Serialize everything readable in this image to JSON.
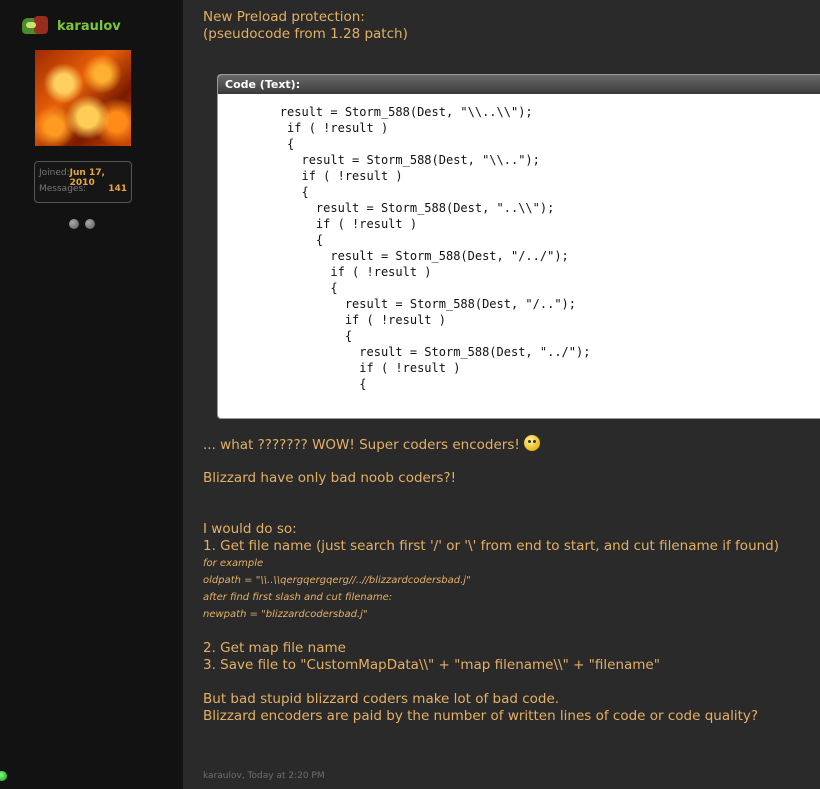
{
  "user": {
    "name": "karaulov",
    "joined_label": "Joined:",
    "joined_value": "Jun 17, 2010",
    "messages_label": "Messages:",
    "messages_value": "141"
  },
  "post": {
    "intro_1": "New Preload protection:",
    "intro_2": "(pseudocode from 1.28 patch)",
    "code_header": "Code (Text):",
    "code_lines": [
      "        result = Storm_588(Dest, \"\\\\..\\\\\");",
      "         if ( !result )",
      "         {",
      "           result = Storm_588(Dest, \"\\\\..\");",
      "           if ( !result )",
      "           {",
      "             result = Storm_588(Dest, \"..\\\\\");",
      "             if ( !result )",
      "             {",
      "               result = Storm_588(Dest, \"/../\");",
      "               if ( !result )",
      "               {",
      "                 result = Storm_588(Dest, \"/..\");",
      "                 if ( !result )",
      "                 {",
      "                   result = Storm_588(Dest, \"../\");",
      "                   if ( !result )",
      "                   {"
    ],
    "reaction": "... what ??????? WOW! Super coders encoders!",
    "smiley_icon": "big-grin-smiley",
    "line_bad_coders": "Blizzard have only bad noob coders?!",
    "would_do": "I would do so:",
    "step_1": "1. Get file name (just search first '/' or '\\' from end to start, and cut filename if found)",
    "example_1": "for example",
    "example_2": "oldpath = \"\\\\..\\\\qergqergqerg//..//blizzardcodersbad.j\"",
    "example_3": "after find first slash and cut filename:",
    "example_4": "newpath = \"blizzardcodersbad.j\"",
    "step_2": "2. Get map file name",
    "step_3": "3. Save file to \"CustomMapData\\\\\" + \"map filename\\\\\" + \"filename\"",
    "closing_1": "But bad stupid blizzard coders make lot of bad code.",
    "closing_2": "Blizzard encoders are paid by the number of written lines of code or code quality?"
  },
  "footer": "karaulov, Today at 2:20 PM",
  "colors": {
    "background": "#2a2a2a",
    "sidebar": "#121212",
    "post_text": "#e4b066",
    "username": "#7cc63a",
    "stat_value": "#e6a640"
  }
}
